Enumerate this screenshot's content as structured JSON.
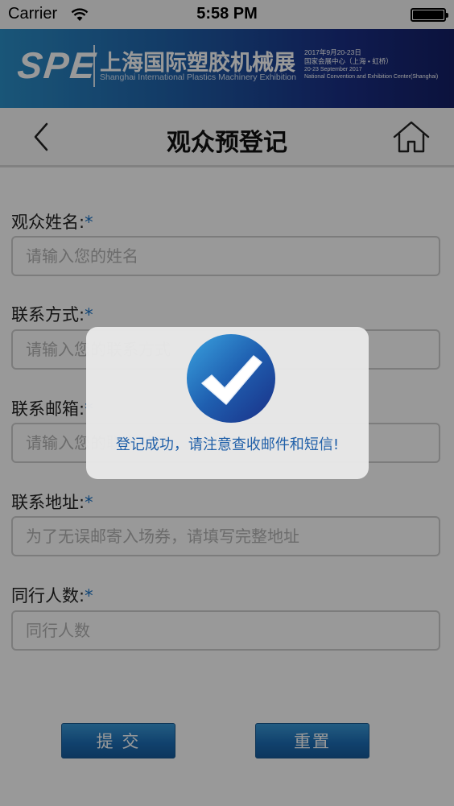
{
  "status_bar": {
    "carrier": "Carrier",
    "time": "5:58 PM",
    "icons": [
      "wifi-icon",
      "battery-icon"
    ]
  },
  "banner": {
    "logo": "SPE",
    "title_cn": "上海国际塑胶机械展",
    "title_en": "Shanghai International Plastics Machinery Exhibition",
    "date_cn": "2017年9月20-23日",
    "venue_cn": "国家会展中心（上海 • 虹桥）",
    "date_en": "20-23 September 2017",
    "venue_en": "National Convention and Exhibition Center(Shanghai)"
  },
  "nav": {
    "title": "观众预登记",
    "icons": [
      "back-chevron-icon",
      "home-icon"
    ]
  },
  "form": {
    "fields": [
      {
        "label": "观众姓名:",
        "required_mark": "*",
        "placeholder": "请输入您的姓名",
        "value": ""
      },
      {
        "label": "联系方式:",
        "required_mark": "*",
        "placeholder": "请输入您的联系方式",
        "value": ""
      },
      {
        "label": "联系邮箱:",
        "required_mark": "*",
        "placeholder": "请输入您的联系邮箱",
        "value": ""
      },
      {
        "label": "联系地址:",
        "required_mark": "*",
        "placeholder": "为了无误邮寄入场券，请填写完整地址",
        "value": ""
      },
      {
        "label": "同行人数:",
        "required_mark": "*",
        "placeholder": "同行人数",
        "value": ""
      }
    ],
    "submit_label": "提 交",
    "reset_label": "重置"
  },
  "toast": {
    "message": "登记成功，请注意查收邮件和短信!",
    "icon": "success-check-icon"
  },
  "colors": {
    "accent": "#1f6fb8",
    "banner_dark": "#141f66",
    "required": "#1a73c7",
    "toast_text": "#1f5fa8"
  }
}
